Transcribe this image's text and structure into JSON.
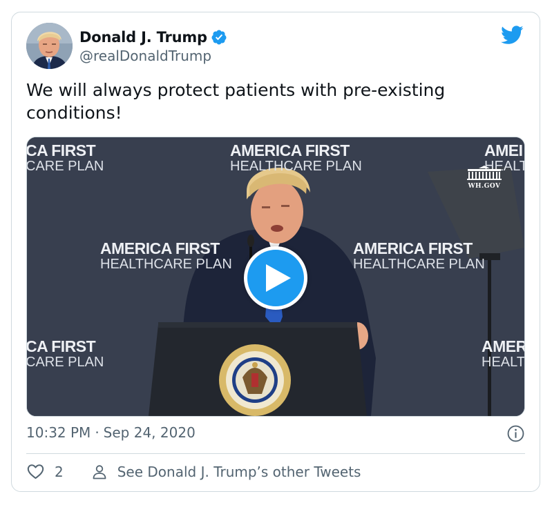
{
  "author": {
    "display_name": "Donald J. Trump",
    "handle": "@realDonaldTrump",
    "verified": true
  },
  "tweet": {
    "text": "We will always protect patients with pre-existing conditions!",
    "time": "10:32 PM",
    "separator": "·",
    "date": "Sep 24, 2020"
  },
  "media": {
    "type": "video",
    "backdrop_line1": "AMERICA FIRST",
    "backdrop_line2": "HEALTHCARE PLAN",
    "crop_topleft_line1": "CA FIRST",
    "crop_topleft_line2": "CARE PLAN",
    "crop_topright_line1": "AMEI",
    "crop_topright_line2": "HEALT",
    "crop_midleft_line1": "AMERICA FIRST",
    "crop_midleft_line2": "HEALTHCARE PLAN",
    "crop_midright_line1": "AMERICA FIRST",
    "crop_midright_line2": "HEALTHCARE PLAN",
    "crop_bottomleft_line1": "CA FIRST",
    "crop_bottomleft_line2": "CARE PLAN",
    "crop_bottomright_line1": "AMER",
    "crop_bottomright_line2": "HEALTI",
    "watermark": "WH.GOV",
    "seal_text": "SEAL OF THE PRESIDENT OF THE UNITED STATES"
  },
  "actions": {
    "like_count": "2",
    "other_tweets_label": "See Donald J. Trump’s other Tweets"
  },
  "colors": {
    "accent": "#1d9bf0",
    "text_primary": "#0f1419",
    "text_secondary": "#536471",
    "border": "#cfd9de",
    "backdrop": "#3b4253"
  },
  "icons": {
    "verified": "verified-badge-icon",
    "logo": "twitter-bird-icon",
    "info": "info-icon",
    "like": "heart-icon",
    "profile": "person-icon",
    "play": "play-icon"
  }
}
